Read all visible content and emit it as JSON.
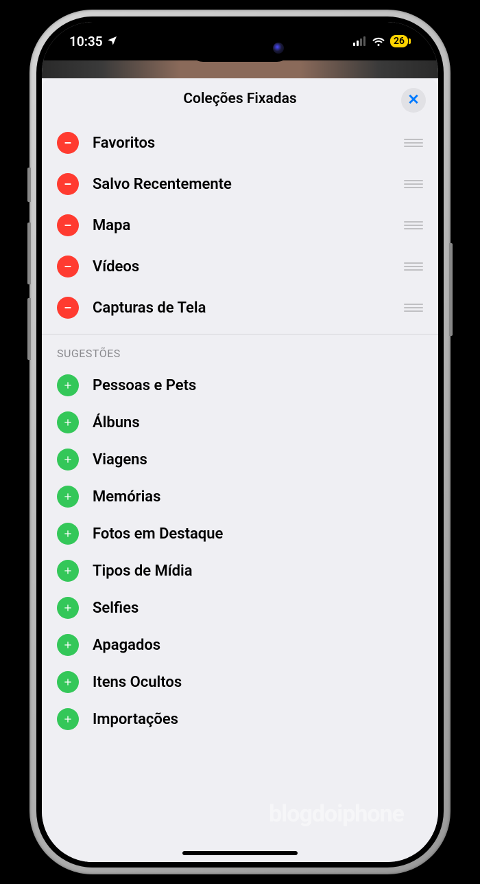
{
  "statusBar": {
    "time": "10:35",
    "battery": "26"
  },
  "sheet": {
    "title": "Coleções Fixadas"
  },
  "pinned": [
    {
      "label": "Favoritos"
    },
    {
      "label": "Salvo Recentemente"
    },
    {
      "label": "Mapa"
    },
    {
      "label": "Vídeos"
    },
    {
      "label": "Capturas de Tela"
    }
  ],
  "suggestionsHeader": "SUGESTÕES",
  "suggestions": [
    {
      "label": "Pessoas e Pets"
    },
    {
      "label": "Álbuns"
    },
    {
      "label": "Viagens"
    },
    {
      "label": "Memórias"
    },
    {
      "label": "Fotos em Destaque"
    },
    {
      "label": "Tipos de Mídia"
    },
    {
      "label": "Selfies"
    },
    {
      "label": "Apagados"
    },
    {
      "label": "Itens Ocultos"
    },
    {
      "label": "Importações"
    }
  ],
  "watermark": "blogdoiphone"
}
